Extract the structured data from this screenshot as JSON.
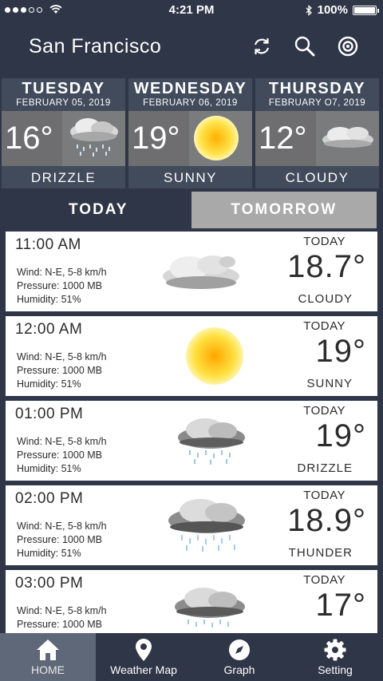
{
  "status": {
    "time": "4:21 PM",
    "battery": "100%"
  },
  "header": {
    "city": "San Francisco"
  },
  "days": [
    {
      "day": "TUESDAY",
      "date": "FEBRUARY 05, 2019",
      "temp": "16°",
      "condition": "DRIZZLE",
      "icon": "drizzle-cloud-icon"
    },
    {
      "day": "WEDNESDAY",
      "date": "FEBRUARY 06, 2019",
      "temp": "19°",
      "condition": "SUNNY",
      "icon": "sun-icon"
    },
    {
      "day": "THURSDAY",
      "date": "FEBRUARY O7, 2019",
      "temp": "12°",
      "condition": "CLOUDY",
      "icon": "cloud-icon"
    }
  ],
  "tabs": {
    "today": "TODAY",
    "tomorrow": "TOMORROW"
  },
  "hours": [
    {
      "time": "11:00 AM",
      "wind": "Wind: N-E, 5-8 km/h",
      "pressure": "Pressure: 1000 MB",
      "humidity": "Humidity: 51%",
      "day": "TODAY",
      "temp": "18.7°",
      "condition": "CLOUDY",
      "icon": "cloud-icon"
    },
    {
      "time": "12:00 AM",
      "wind": "Wind: N-E, 5-8 km/h",
      "pressure": "Pressure: 1000 MB",
      "humidity": "Humidity: 51%",
      "day": "TODAY",
      "temp": "19°",
      "condition": "SUNNY",
      "icon": "sun-icon"
    },
    {
      "time": "01:00 PM",
      "wind": "Wind: N-E, 5-8 km/h",
      "pressure": "Pressure: 1000 MB",
      "humidity": "Humidity: 51%",
      "day": "TODAY",
      "temp": "19°",
      "condition": "DRIZZLE",
      "icon": "drizzle-cloud-icon"
    },
    {
      "time": "02:00 PM",
      "wind": "Wind: N-E, 5-8 km/h",
      "pressure": "Pressure: 1000 MB",
      "humidity": "Humidity: 51%",
      "day": "TODAY",
      "temp": "18.9°",
      "condition": "THUNDER",
      "icon": "thunder-cloud-icon"
    },
    {
      "time": "03:00 PM",
      "wind": "Wind: N-E, 5-8 km/h",
      "pressure": "Pressure: 1000 MB",
      "humidity": "",
      "day": "TODAY",
      "temp": "17°",
      "condition": "",
      "icon": "rain-cloud-icon"
    }
  ],
  "nav": [
    {
      "label": "HOME",
      "icon": "home-icon"
    },
    {
      "label": "Weather Map",
      "icon": "map-pin-icon"
    },
    {
      "label": "Graph",
      "icon": "compass-icon"
    },
    {
      "label": "Setting",
      "icon": "gear-icon"
    }
  ]
}
